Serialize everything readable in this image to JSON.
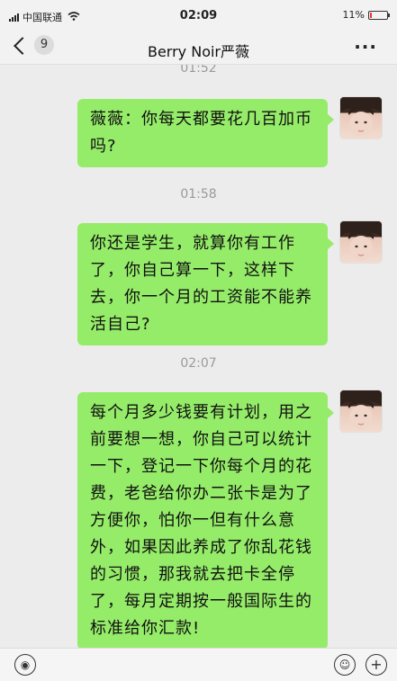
{
  "status_bar": {
    "carrier": "中国联通",
    "wifi_icon": "wifi-icon",
    "time": "02:09",
    "battery_percent": "11%",
    "battery_level": 0.11
  },
  "nav": {
    "back_icon": "chevron-left-icon",
    "unread_count": "9",
    "title": "Berry Noir严薇",
    "more_label": "···"
  },
  "chat": {
    "top_timestamp": "01:52",
    "messages": [
      {
        "text": "薇薇：你每天都要花几百加币吗?",
        "sender": "self"
      },
      {
        "timestamp": "01:58",
        "text": "你还是学生，就算你有工作了，你自己算一下，这样下去，你一个月的工资能不能养活自己?",
        "sender": "self"
      },
      {
        "timestamp": "02:07",
        "text": "每个月多少钱要有计划，用之前要想一想，你自己可以统计一下，登记一下你每个月的花费，老爸给你办二张卡是为了方便你，怕你一但有什么意外，如果因此养成了你乱花钱的习惯，那我就去把卡全停了，每月定期按一般国际生的标准给你汇款!",
        "sender": "self"
      }
    ]
  },
  "input_bar": {
    "voice_icon": "voice-icon",
    "emoji_icon": "emoji-icon",
    "plus_icon": "plus-icon",
    "plus_label": "+",
    "emoji_label": "☺",
    "voice_label": "◉"
  },
  "colors": {
    "bubble": "#95ec69",
    "background": "#ececec",
    "bar": "#f2f2f2"
  }
}
